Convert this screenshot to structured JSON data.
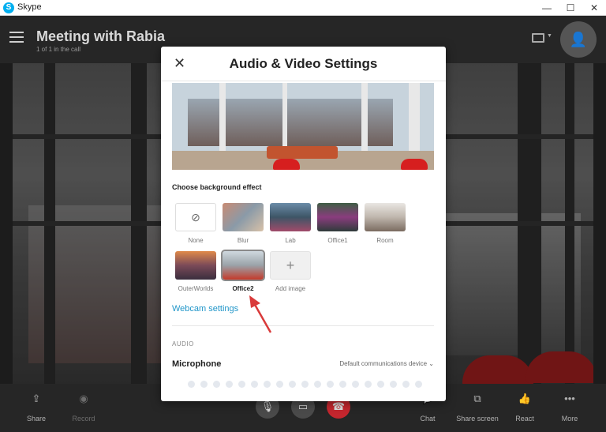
{
  "window": {
    "title": "Skype",
    "controls": [
      "—",
      "☐",
      "✕"
    ]
  },
  "meeting": {
    "title": "Meeting with Rabia",
    "subtitle": "1 of 1 in the call"
  },
  "call_bar": {
    "share": "Share",
    "record": "Record",
    "chat": "Chat",
    "share_screen": "Share screen",
    "react": "React",
    "more": "More"
  },
  "dialog": {
    "title": "Audio & Video Settings",
    "close_glyph": "✕",
    "background_section_label": "Choose background effect",
    "effects": [
      {
        "label": "None",
        "selected": false
      },
      {
        "label": "Blur",
        "selected": false
      },
      {
        "label": "Lab",
        "selected": false
      },
      {
        "label": "Office1",
        "selected": false
      },
      {
        "label": "Room",
        "selected": false
      },
      {
        "label": "OuterWorlds",
        "selected": false
      },
      {
        "label": "Office2",
        "selected": true
      },
      {
        "label": "Add image",
        "selected": false
      }
    ],
    "webcam_settings_link": "Webcam settings",
    "audio_section_label": "AUDIO",
    "microphone_label": "Microphone",
    "microphone_device": "Default communications device"
  },
  "colors": {
    "accent_link": "#2196c9",
    "end_call": "#c4262e"
  }
}
